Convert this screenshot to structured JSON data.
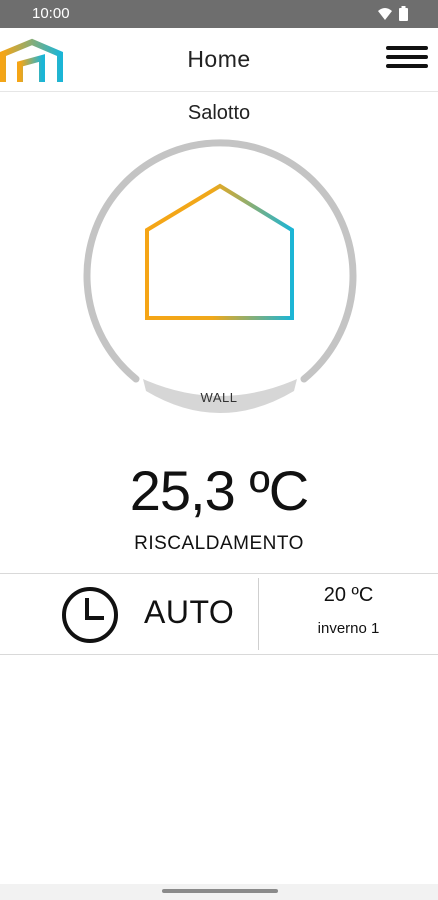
{
  "status_bar": {
    "time": "10:00",
    "icons": [
      "wifi-icon",
      "battery-icon"
    ]
  },
  "app_bar": {
    "title": "Home",
    "menu_icon": "hamburger-menu-icon",
    "logo_icon": "house-logo-icon"
  },
  "room": {
    "name": "Salotto",
    "device_label": "WALL",
    "temperature": "25,3 ºC",
    "mode": "RISCALDAMENTO"
  },
  "program": {
    "icon": "clock-icon",
    "mode_label": "AUTO",
    "setpoint": "20 ºC",
    "program_name": "inverno 1"
  },
  "colors": {
    "gradient_start": "#f5a516",
    "gradient_end": "#1bb5d6",
    "ring": "#c4c4c4",
    "status_bar": "#6e6e6e"
  }
}
